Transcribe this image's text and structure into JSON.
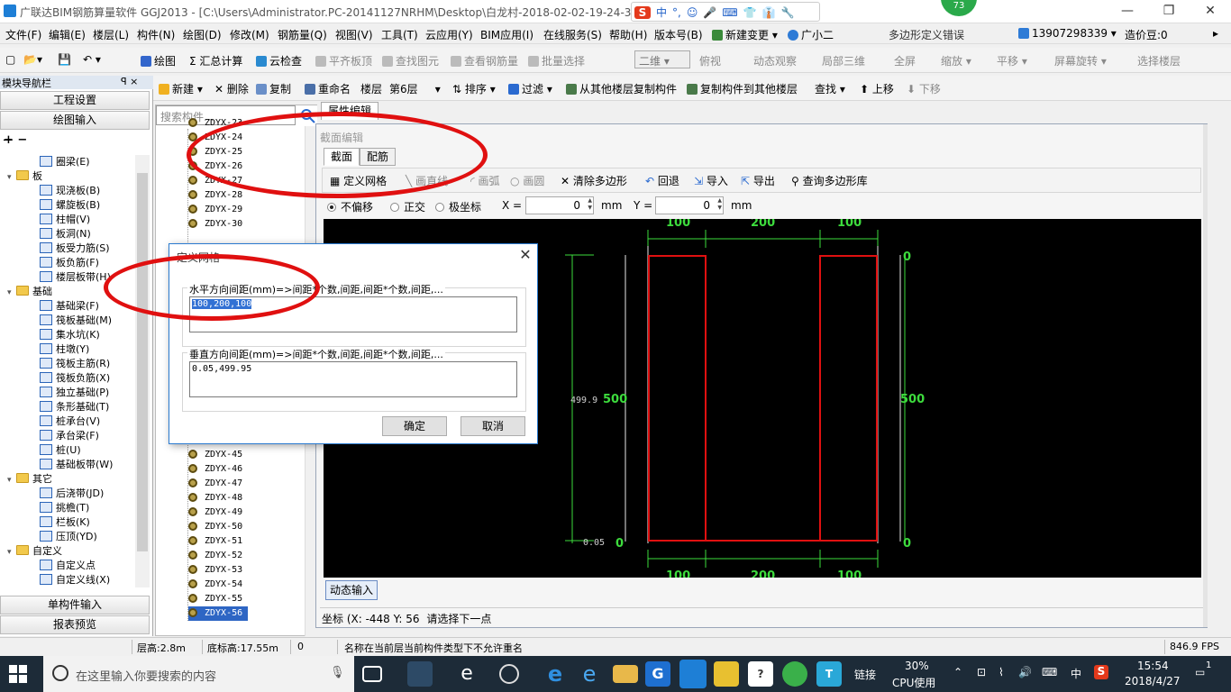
{
  "title_bar": {
    "title": "广联达BIM钢筋算量软件 GGJ2013 - [C:\\Users\\Administrator.PC-20141127NRHM\\Desktop\\白龙村-2018-02-02-19-24-35",
    "ime_items": [
      "S",
      "中",
      "°,",
      "☺",
      "🎤",
      "⌨",
      "👕",
      "👔",
      "🔧"
    ],
    "badge": "73",
    "minimize": "—",
    "restore": "❐",
    "close": "✕"
  },
  "menubar": {
    "items": [
      "文件(F)",
      "编辑(E)",
      "楼层(L)",
      "构件(N)",
      "绘图(D)",
      "修改(M)",
      "钢筋量(Q)",
      "视图(V)",
      "工具(T)",
      "云应用(Y)",
      "BIM应用(I)",
      "在线服务(S)",
      "帮助(H)",
      "版本号(B)",
      "新建变更",
      "广小二"
    ],
    "warning": "多边形定义错误",
    "phone": "13907298339",
    "price": "造价豆:0"
  },
  "toolbar1": {
    "items": [
      "绘图",
      "Σ 汇总计算",
      "云检查",
      "平齐板顶",
      "查找图元",
      "查看钢筋量",
      "批量选择",
      "二维",
      "俯视",
      "动态观察",
      "局部三维",
      "全屏",
      "缩放",
      "平移",
      "屏幕旋转",
      "选择楼层"
    ]
  },
  "left_panel": {
    "header": "模块导航栏",
    "pin": "ꟼ ×",
    "btn_settings": "工程设置",
    "btn_draw": "绘图输入",
    "btn_single": "单构件输入",
    "btn_report": "报表预览",
    "tree": [
      {
        "label": "圈梁(E)",
        "level": 2,
        "kind": "item"
      },
      {
        "label": "板",
        "level": 1,
        "kind": "folder"
      },
      {
        "label": "现浇板(B)",
        "level": 2,
        "kind": "item"
      },
      {
        "label": "螺旋板(B)",
        "level": 2,
        "kind": "item"
      },
      {
        "label": "柱帽(V)",
        "level": 2,
        "kind": "item"
      },
      {
        "label": "板洞(N)",
        "level": 2,
        "kind": "item"
      },
      {
        "label": "板受力筋(S)",
        "level": 2,
        "kind": "item"
      },
      {
        "label": "板负筋(F)",
        "level": 2,
        "kind": "item"
      },
      {
        "label": "楼层板带(H)",
        "level": 2,
        "kind": "item"
      },
      {
        "label": "基础",
        "level": 1,
        "kind": "folder"
      },
      {
        "label": "基础梁(F)",
        "level": 2,
        "kind": "item"
      },
      {
        "label": "筏板基础(M)",
        "level": 2,
        "kind": "item"
      },
      {
        "label": "集水坑(K)",
        "level": 2,
        "kind": "item"
      },
      {
        "label": "柱墩(Y)",
        "level": 2,
        "kind": "item"
      },
      {
        "label": "筏板主筋(R)",
        "level": 2,
        "kind": "item"
      },
      {
        "label": "筏板负筋(X)",
        "level": 2,
        "kind": "item"
      },
      {
        "label": "独立基础(P)",
        "level": 2,
        "kind": "item"
      },
      {
        "label": "条形基础(T)",
        "level": 2,
        "kind": "item"
      },
      {
        "label": "桩承台(V)",
        "level": 2,
        "kind": "item"
      },
      {
        "label": "承台梁(F)",
        "level": 2,
        "kind": "item"
      },
      {
        "label": "桩(U)",
        "level": 2,
        "kind": "item"
      },
      {
        "label": "基础板带(W)",
        "level": 2,
        "kind": "item"
      },
      {
        "label": "其它",
        "level": 1,
        "kind": "folder"
      },
      {
        "label": "后浇带(JD)",
        "level": 2,
        "kind": "item"
      },
      {
        "label": "挑檐(T)",
        "level": 2,
        "kind": "item"
      },
      {
        "label": "栏板(K)",
        "level": 2,
        "kind": "item"
      },
      {
        "label": "压顶(YD)",
        "level": 2,
        "kind": "item"
      },
      {
        "label": "自定义",
        "level": 1,
        "kind": "folder"
      },
      {
        "label": "自定义点",
        "level": 2,
        "kind": "item"
      },
      {
        "label": "自定义线(X)",
        "level": 2,
        "kind": "item"
      }
    ]
  },
  "toolbar2": {
    "items": [
      "新建",
      "删除",
      "复制",
      "重命名",
      "楼层",
      "第6层",
      "排序",
      "过滤",
      "从其他楼层复制构件",
      "复制构件到其他楼层",
      "查找",
      "上移",
      "下移"
    ]
  },
  "list_panel": {
    "search_placeholder": "搜索构件...",
    "items_top": [
      "ZDYX-23",
      "ZDYX-24",
      "ZDYX-25",
      "ZDYX-26",
      "ZDYX-27",
      "ZDYX-28",
      "ZDYX-29",
      "ZDYX-30"
    ],
    "items_bottom": [
      "ZDYX-45",
      "ZDYX-46",
      "ZDYX-47",
      "ZDYX-48",
      "ZDYX-49",
      "ZDYX-50",
      "ZDYX-51",
      "ZDYX-52",
      "ZDYX-53",
      "ZDYX-54",
      "ZDYX-55",
      "ZDYX-56"
    ],
    "selected": "ZDYX-56"
  },
  "editor": {
    "prop_tab": "属性编辑",
    "title": "截面编辑",
    "tabs": [
      "截面",
      "配筋"
    ],
    "tools": [
      "定义网格",
      "画直线",
      "画弧",
      "画圆",
      "清除多边形",
      "回退",
      "导入",
      "导出",
      "查询多边形库"
    ],
    "modes": [
      "不偏移",
      "正交",
      "极坐标"
    ],
    "x_label": "X =",
    "x_value": "0",
    "y_label": "Y =",
    "y_value": "0",
    "unit": "mm",
    "dynamic_btn": "动态输入",
    "coord_text": "坐标 (X: -448 Y: 56",
    "hint": "请选择下一点"
  },
  "drawing": {
    "top_dims": [
      "100",
      "200",
      "100"
    ],
    "bottom_dims": [
      "100",
      "200",
      "100"
    ],
    "left_dim": "500",
    "right_dim": "500",
    "left_small": "499.9",
    "bottom_small": "0.05",
    "zero": "0"
  },
  "dialog": {
    "title": "定义网格",
    "h_label": "水平方向间距(mm)=>间距*个数,间距,间距*个数,间距,...",
    "h_value": "100,200,100",
    "v_label": "垂直方向间距(mm)=>间距*个数,间距,间距*个数,间距,...",
    "v_value": "0.05,499.95",
    "ok": "确定",
    "cancel": "取消",
    "close": "✕"
  },
  "status_bar": {
    "floor_height": "层高:2.8m",
    "bottom_height": "底标高:17.55m",
    "zero": "0",
    "message": "名称在当前层当前构件类型下不允许重名",
    "fps": "846.9 FPS"
  },
  "taskbar": {
    "search_placeholder": "在这里输入你要搜索的内容",
    "link": "链接",
    "cpu_percent": "30%",
    "cpu_label": "CPU使用",
    "ime": "中",
    "time": "15:54",
    "date": "2018/4/27",
    "notify": "1"
  },
  "colors": {
    "accent": "#2b7bd0",
    "annotation_red": "#e01010",
    "canvas_bg": "#000000",
    "dim_green": "#3ddc3d",
    "shape_red": "#e01010"
  }
}
